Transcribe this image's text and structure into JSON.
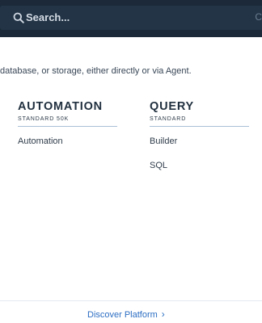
{
  "header": {
    "search_placeholder": "Search...",
    "shortcut_hint": "C"
  },
  "intro": {
    "text": "database, or storage, either directly or via Agent."
  },
  "columns": [
    {
      "title": "AUTOMATION",
      "tier": "STANDARD 50K",
      "items": [
        "Automation"
      ]
    },
    {
      "title": "QUERY",
      "tier": "STANDARD",
      "items": [
        "Builder",
        "SQL"
      ]
    }
  ],
  "footer": {
    "discover_label": "Discover Platform",
    "discover_icon": "chevron-right-icon"
  },
  "colors": {
    "header_bg": "#1b2938",
    "link": "#2c6ec3"
  }
}
